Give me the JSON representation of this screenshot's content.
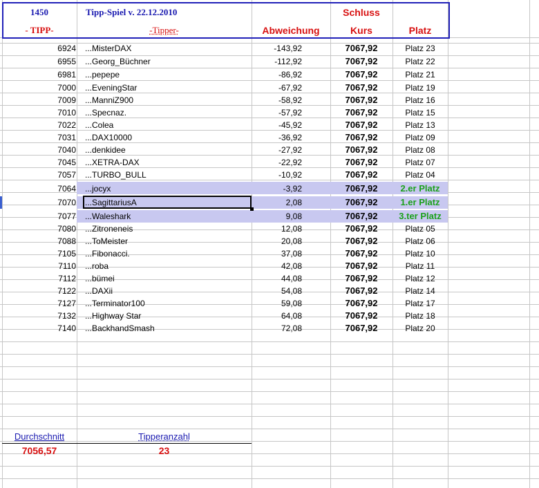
{
  "header": {
    "tipp_count": "1450",
    "game_title": "Tipp-Spiel v. 22.12.2010",
    "schluss": "Schluss",
    "col_tipp": "- TIPP-",
    "col_tipper": "-Tipper-",
    "col_abweichung": "Abweichung",
    "col_kurs": "Kurs",
    "col_platz": "Platz"
  },
  "rows": [
    {
      "tipp": "6924",
      "name": "...MisterDAX",
      "abw": "-143,92",
      "kurs": "7067,92",
      "platz": "Platz 23"
    },
    {
      "tipp": "6955",
      "name": "...Georg_Büchner",
      "abw": "-112,92",
      "kurs": "7067,92",
      "platz": "Platz 22"
    },
    {
      "tipp": "6981",
      "name": "...pepepe",
      "abw": "-86,92",
      "kurs": "7067,92",
      "platz": "Platz 21"
    },
    {
      "tipp": "7000",
      "name": "...EveningStar",
      "abw": "-67,92",
      "kurs": "7067,92",
      "platz": "Platz 19"
    },
    {
      "tipp": "7009",
      "name": "...ManniZ900",
      "abw": "-58,92",
      "kurs": "7067,92",
      "platz": "Platz 16"
    },
    {
      "tipp": "7010",
      "name": "...Specnaz.",
      "abw": "-57,92",
      "kurs": "7067,92",
      "platz": "Platz 15"
    },
    {
      "tipp": "7022",
      "name": "...Colea",
      "abw": "-45,92",
      "kurs": "7067,92",
      "platz": "Platz 13"
    },
    {
      "tipp": "7031",
      "name": "...DAX10000",
      "abw": "-36,92",
      "kurs": "7067,92",
      "platz": "Platz 09"
    },
    {
      "tipp": "7040",
      "name": "...denkidee",
      "abw": "-27,92",
      "kurs": "7067,92",
      "platz": "Platz 08"
    },
    {
      "tipp": "7045",
      "name": "...XETRA-DAX",
      "abw": "-22,92",
      "kurs": "7067,92",
      "platz": "Platz 07"
    },
    {
      "tipp": "7057",
      "name": "...TURBO_BULL",
      "abw": "-10,92",
      "kurs": "7067,92",
      "platz": "Platz 04"
    },
    {
      "tipp": "7064",
      "name": "...jocyx",
      "abw": "-3,92",
      "kurs": "7067,92",
      "platz": "2.er Platz"
    },
    {
      "tipp": "7070",
      "name": "...SagittariusA",
      "abw": "2,08",
      "kurs": "7067,92",
      "platz": "1.er Platz"
    },
    {
      "tipp": "7077",
      "name": "...Waleshark",
      "abw": "9,08",
      "kurs": "7067,92",
      "platz": "3.ter Platz"
    },
    {
      "tipp": "7080",
      "name": "...Zitroneneis",
      "abw": "12,08",
      "kurs": "7067,92",
      "platz": "Platz 05"
    },
    {
      "tipp": "7088",
      "name": "...ToMeister",
      "abw": "20,08",
      "kurs": "7067,92",
      "platz": "Platz 06"
    },
    {
      "tipp": "7105",
      "name": "...Fibonacci.",
      "abw": "37,08",
      "kurs": "7067,92",
      "platz": "Platz 10"
    },
    {
      "tipp": "7110",
      "name": "...roba",
      "abw": "42,08",
      "kurs": "7067,92",
      "platz": "Platz 11"
    },
    {
      "tipp": "7112",
      "name": "...bümei",
      "abw": "44,08",
      "kurs": "7067,92",
      "platz": "Platz 12"
    },
    {
      "tipp": "7122",
      "name": "...DAXii",
      "abw": "54,08",
      "kurs": "7067,92",
      "platz": "Platz 14"
    },
    {
      "tipp": "7127",
      "name": "...Terminator100",
      "abw": "59,08",
      "kurs": "7067,92",
      "platz": "Platz 17"
    },
    {
      "tipp": "7132",
      "name": "...Highway Star",
      "abw": "64,08",
      "kurs": "7067,92",
      "platz": "Platz 18"
    },
    {
      "tipp": "7140",
      "name": "...BackhandSmash",
      "abw": "72,08",
      "kurs": "7067,92",
      "platz": "Platz 20"
    }
  ],
  "footer": {
    "durchschnitt_label": "Durchschnitt",
    "durchschnitt_value": "7056,57",
    "tipperanzahl_label": "Tipperanzahl",
    "tipperanzahl_value": "23"
  },
  "colors": {
    "header_blue": "#1a1ab0",
    "header_red": "#d81010",
    "winner_green": "#1aa01a",
    "highlight": "#c8c8f0"
  }
}
